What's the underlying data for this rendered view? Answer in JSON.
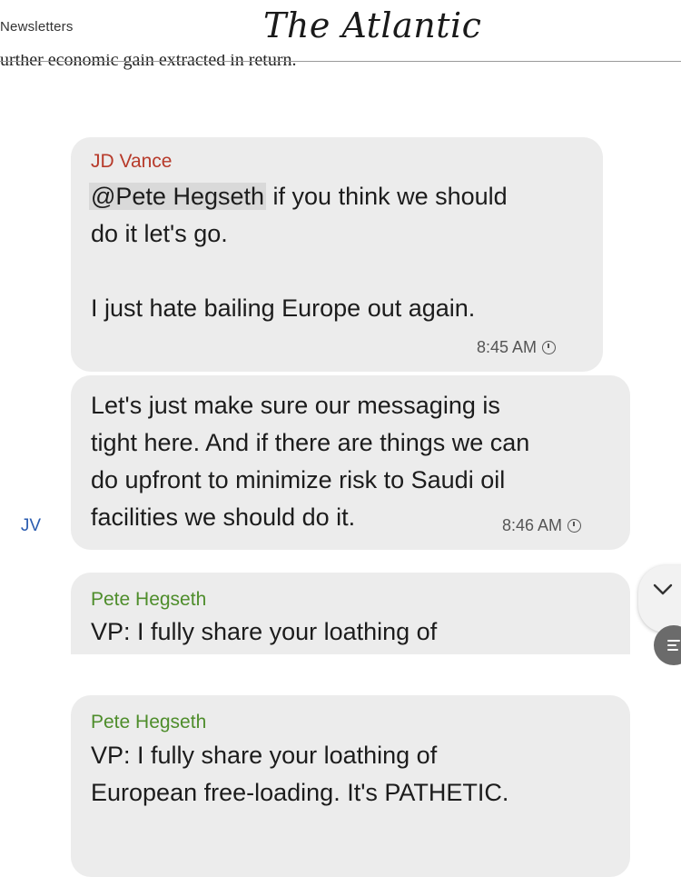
{
  "header": {
    "newsletters_label": "Newsletters",
    "brand": "The Atlantic",
    "article_fragment": "urther economic gain extracted in return."
  },
  "messages": [
    {
      "sender": "JD Vance",
      "mention": "@Pete Hegseth",
      "text_after_mention": " if you think we should\ndo it let's go.\n\nI just hate bailing Europe out again.",
      "time": "8:45 AM"
    },
    {
      "text": "Let's just make sure our messaging is\ntight here. And if there are things we can\ndo upfront to minimize risk to Saudi oil\nfacilities we should do it.",
      "time": "8:46 AM",
      "avatar_initials": "JV"
    },
    {
      "sender": "Pete Hegseth",
      "text": "VP: I fully share your loathing of\nEuropean free-loading. It's PATHETIC."
    },
    {
      "sender": "Pete Hegseth",
      "text": "VP: I fully share your loathing of\nEuropean free-loading. It's PATHETIC."
    }
  ],
  "colors": {
    "bubble": "#ececec",
    "sender_jd": "#b73a2a",
    "sender_pete": "#4e8d2b",
    "avatar": "#2b5cb0"
  },
  "icons": {
    "scroll_down": "chevron-down-icon",
    "quick_action": "reply-icon",
    "time_status": "clock-icon"
  }
}
